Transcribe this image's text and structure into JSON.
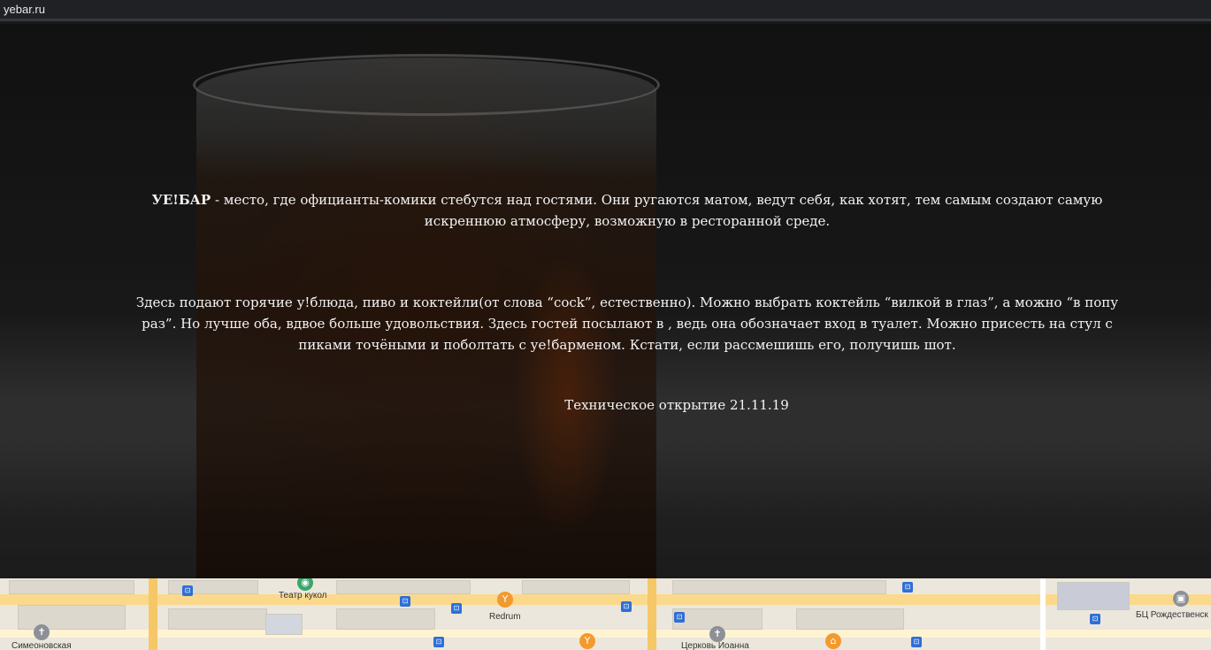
{
  "browser": {
    "url": "yebar.ru"
  },
  "hero": {
    "paragraph1": {
      "brand": "УЕ!БАР",
      "text": " - место, где официанты-комики стебутся над гостями. Они ругаются матом, ведут себя, как хотят, тем самым создают самую искреннюю атмосферу, возможную в ресторанной среде."
    },
    "paragraph2": "Здесь подают горячие у!блюда, пиво и коктейли(от слова “cock”, естественно). Можно выбрать коктейль “вилкой в глаз”, а можно “в попу раз”. Но лучше оба, вдвое больше удовольствия. Здесь гостей посылают в  , ведь она обозначает вход в туалет. Можно присесть на стул с пиками точёными и поболтать с уе!барменом. Кстати, если рассмешишь его, получишь шот.",
    "paragraph3": "Техническое открытие 21.11.19"
  },
  "map": {
    "labels": {
      "teatr": "Театр кукол",
      "redrum": "Redrum",
      "simeonovskaya": "Симеоновская",
      "church": "Церковь Иоанна",
      "bc": "БЦ Рождественск"
    },
    "colors": {
      "background": "#ece7dc",
      "main_road": "#fbd98c",
      "orange_pin": "#f39a2e",
      "green_pin": "#3aa66a",
      "gray_pin": "#8d9096",
      "bus": "#2f6fd6"
    }
  }
}
